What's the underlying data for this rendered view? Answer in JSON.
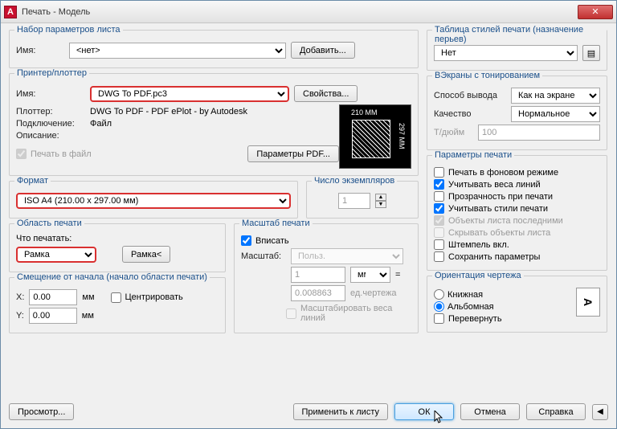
{
  "window": {
    "title": "Печать - Модель",
    "close": "✕"
  },
  "pageSetup": {
    "groupTitle": "Набор параметров листа",
    "nameLabel": "Имя:",
    "nameValue": "<нет>",
    "addButton": "Добавить..."
  },
  "printer": {
    "groupTitle": "Принтер/плоттер",
    "nameLabel": "Имя:",
    "nameValue": "DWG To PDF.pc3",
    "propsButton": "Свойства...",
    "plotterLabel": "Плоттер:",
    "plotterValue": "DWG To PDF - PDF ePlot - by Autodesk",
    "connLabel": "Подключение:",
    "connValue": "Файл",
    "descLabel": "Описание:",
    "printToFile": "Печать в файл",
    "pdfParamsButton": "Параметры PDF...",
    "previewW": "210 MM",
    "previewH": "297 MM"
  },
  "format": {
    "groupTitle": "Формат",
    "value": "ISO A4 (210.00 x 297.00 мм)",
    "copiesLabel": "Число экземпляров",
    "copiesValue": "1"
  },
  "plotArea": {
    "groupTitle": "Область печати",
    "whatLabel": "Что печатать:",
    "value": "Рамка",
    "frameButton": "Рамка<"
  },
  "offset": {
    "groupTitle": "Смещение от начала (начало области печати)",
    "xLabel": "X:",
    "xValue": "0.00",
    "yLabel": "Y:",
    "yValue": "0.00",
    "unit": "мм",
    "centerLabel": "Центрировать"
  },
  "scale": {
    "groupTitle": "Масштаб печати",
    "fitLabel": "Вписать",
    "scaleLabel": "Масштаб:",
    "scaleValue": "Польз.",
    "unitVal": "1",
    "unitSel": "мм",
    "drawingVal": "0.008863",
    "drawingUnit": "ед.чертежа",
    "scaleLineWeights": "Масштабировать веса линий"
  },
  "plotStyle": {
    "groupTitle": "Таблица стилей печати (назначение перьев)",
    "value": "Нет"
  },
  "viewport": {
    "groupTitle": "ВЭкраны с тонированием",
    "modeLabel": "Способ вывода",
    "modeValue": "Как на экране",
    "qualityLabel": "Качество",
    "qualityValue": "Нормальное",
    "dpiLabel": "Т/дюйм",
    "dpiValue": "100"
  },
  "plotParams": {
    "groupTitle": "Параметры печати",
    "bg": "Печать в фоновом режиме",
    "lw": "Учитывать веса линий",
    "trans": "Прозрачность при печати",
    "styles": "Учитывать стили печати",
    "paperLast": "Объекты листа последними",
    "hideSheets": "Скрывать объекты листа",
    "stamp": "Штемпель вкл.",
    "save": "Сохранить параметры"
  },
  "orient": {
    "groupTitle": "Ориентация чертежа",
    "portrait": "Книжная",
    "landscape": "Альбомная",
    "flip": "Перевернуть",
    "iconLetter": "A"
  },
  "footer": {
    "preview": "Просмотр...",
    "apply": "Применить к листу",
    "ok": "ОК",
    "cancel": "Отмена",
    "help": "Справка"
  }
}
